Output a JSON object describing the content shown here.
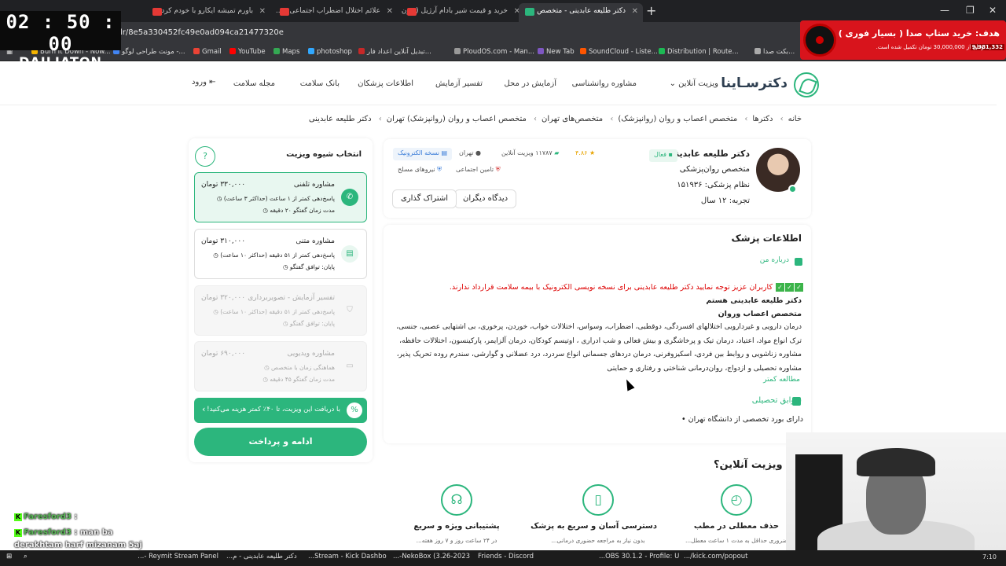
{
  "overlay": {
    "timer": "02 : 50 : 00",
    "streamer": "DAILIATON",
    "goal_title": "هدف: خرید ستاپ صدا ( بسیار فوری )",
    "goal_desc": "تومان از 30,000,000 تومان تکمیل شده است.",
    "goal_amount": "9,981,332"
  },
  "browser": {
    "tabs": [
      {
        "label": "خرید و قیمت شیر بادام آرژیل (بدون...",
        "color": "#e53935"
      },
      {
        "label": "علائم اختلال اضطراب اجتماعی - ...",
        "color": "#e53935"
      },
      {
        "label": "باورم تمیشه ایکارو با خودم کردم",
        "color": "#e53935"
      },
      {
        "label": "دکتر طلیعه عابدینی - متخصص ...",
        "color": "#2cb67d"
      }
    ],
    "url": "/dr/8e5a330452fc49e0ad094ca21477320e",
    "bookmarks": [
      "Burn It Down - Now...",
      "مونت طراحی لوگو -...",
      "Gmail",
      "YouTube",
      "Maps",
      "photoshop",
      "تبدیل آنلاین اعداد فار...",
      "PloudOS.com - Man...",
      "New Tab",
      "SoundCloud - Liste...",
      "Distribution | Route...",
      "بکت صدا..."
    ]
  },
  "site": {
    "logo": "دکترسـاینا",
    "nav": [
      "ویزیت آنلاین",
      "مشاوره روانشناسی",
      "آزمایش در محل",
      "تفسیر آزمایش",
      "اطلاعات پزشکان",
      "بانک سلامت",
      "مجله سلامت"
    ],
    "login": "ورود"
  },
  "breadcrumb": [
    "خانه",
    "دکترها",
    "متخصص اعصاب و روان (روانپزشک)",
    "متخصص‌های تهران",
    "متخصص اعصاب و روان (روانپزشک) تهران",
    "دکتر طلیعه عابدینی"
  ],
  "doctor": {
    "name": "دکتر طلیعه عابدینی",
    "specialty": "متخصص روان‌پزشکی",
    "nezam": "نظام پزشکی: ۱۵۱۹۳۶",
    "experience": "تجربه: ۱۲ سال",
    "status": "فعال",
    "rating": "۴.۸۶",
    "visits": "۱۱۷۸۷ ویزیت آنلاین",
    "city": "تهران",
    "eprescription": "نسخه الکترونیک",
    "insurance_social": "تامین اجتماعی",
    "insurance_army": "نیروهای مسلح",
    "btn_reviews": "دیدگاه دیگران",
    "btn_share": "اشتراک گذاری"
  },
  "info": {
    "title": "اطلاعات پزشک",
    "about_label": "درباره من",
    "notice": "کاربران عزیز توجه نمایید دکتر طلیعه عابدینی برای نسخه نویسی الکترونیک با بیمه سلامت قرارداد ندارند.",
    "line1": "دکتر طلیعه عابدینی هستم",
    "line2": "متخصص اعصاب وروان",
    "bio": "درمان دارویی و غیردارویی اختلالهای افسردگی، دوقطبی، اضطراب، وسواس، اختلالات خواب، خوردن، پرخوری، بی اشتهایی عصبی، جنسی، ترک انواع مواد، اعتیاد، درمان تیک و پرخاشگری و بیش فعالی و شب ادراری ، اوتیسم کودکان، درمان آلزایمر، پارکینسون، اختلالات حافظه، مشاوره زناشویی و روابط بین فردی، اسکیزوفرنی، درمان دردهای جسمانی انواع سردرد، درد عضلانی و گوارشی، سندرم روده تحریک پذیر، مشاوره تحصیلی و ازدواج، روان‌درمانی شناختی و رفتاری و حمایتی",
    "read_more": "مطالعه کمتر",
    "edu_label": "سوابق تحصیلی",
    "edu_item": "دارای بورد تخصصی از دانشگاه تهران"
  },
  "visit": {
    "title": "انتخاب شیوه ویزیت",
    "help_icon": "?",
    "options": [
      {
        "name": "مشاوره تلفنی",
        "price": "۳۳۰,۰۰۰ تومان",
        "d1": "پاسخ‌دهی کمتر از ۱ ساعت (حداکثر ۳ ساعت)",
        "d2": "مدت زمان گفتگو ۲۰ دقیقه"
      },
      {
        "name": "مشاوره متنی",
        "price": "۳۱۰,۰۰۰ تومان",
        "d1": "پاسخ‌دهی کمتر از ۵۱ دقیقه (حداکثر ۱۰ ساعت)",
        "d2": "پایان: توافق گفتگو"
      },
      {
        "name": "تفسیر آزمایش - تصویربرداری",
        "price": "۳۲۰,۰۰۰ تومان",
        "d1": "پاسخ‌دهی کمتر از ۵۱ دقیقه (حداکثر ۱۰ ساعت)",
        "d2": "پایان: توافق گفتگو"
      },
      {
        "name": "مشاوره ویدیویی",
        "price": "۶۹۰,۰۰۰ تومان",
        "d1": "هماهنگی زمان با متخصص",
        "d2": "مدت زمان گفتگو ۴۵ دقیقه"
      }
    ],
    "promo": "با دریافت این ویزیت، تا ۴۰٪ کمتر هزینه می‌کنید!",
    "pay": "ادامه و پرداخت"
  },
  "why": {
    "title": "چرا ویزیت آنلاین؟",
    "features": [
      {
        "title": "حذف معطلی در مطب",
        "desc": "ضروری حداقل به مدت ۱ ساعت معطل..."
      },
      {
        "title": "دسترسی آسان و سریع به پزشک",
        "desc": "بدون نیاز به مراجعه حضوری درمانی..."
      },
      {
        "title": "پشتیبانی ویژه و سریع",
        "desc": "در ۲۴ ساعت روز و ۷ روز هفته..."
      }
    ]
  },
  "chat": [
    {
      "user": "Faresford3",
      "msg": ":"
    },
    {
      "user": "Faresford3",
      "msg": ": man ba"
    },
    {
      "user": "",
      "msg": "derakhtam harf mizanam 5aj"
    }
  ],
  "taskbar": [
    "Reymit Stream Panel -...",
    "دکتر طلیعه عابدینی - م...",
    "Stream - Kick Dashbo...",
    "NekoBox (3.26-2023-...",
    "Friends - Discord",
    "OBS 30.1.2 - Profile: U...",
    "kick.com/popout/..."
  ],
  "clock": "7:10"
}
